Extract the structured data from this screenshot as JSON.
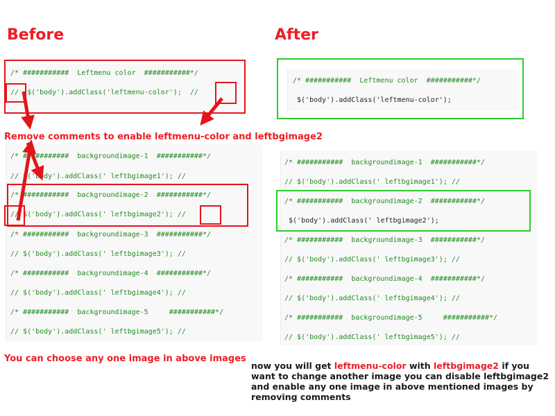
{
  "headings": {
    "before": "Before",
    "after": "After"
  },
  "before": {
    "top_code": [
      "/* ###########  Leftmenu color  ###########*/",
      "//  $('body').addClass('leftmenu-color');  //"
    ],
    "instruction": "Remove comments to enable leftmenu-color and leftbgimage2",
    "bg_code": [
      "/* ###########  backgroundimage-1  ###########*/",
      "// $('body').addClass(' leftbgimage1'); //",
      "/* ###########  backgroundimage-2  ###########*/",
      "// $('body').addClass(' leftbgimage2'); //",
      "/* ###########  backgroundimage-3  ###########*/",
      "// $('body').addClass(' leftbgimage3'); //",
      "/* ###########  backgroundimage-4  ###########*/",
      "// $('body').addClass(' leftbgimage4'); //",
      "/* ###########  backgroundimage-5     ###########*/",
      "// $('body').addClass(' leftbgimage5'); //"
    ],
    "footer": "You can choose any one image in above images"
  },
  "after": {
    "top_code": [
      "/* ###########  Leftmenu color  ###########*/",
      " $('body').addClass('leftmenu-color');"
    ],
    "bg_code": [
      "/* ###########  backgroundimage-1  ###########*/",
      "// $('body').addClass(' leftbgimage1'); //",
      "/* ###########  backgroundimage-2  ###########*/",
      " $('body').addClass(' leftbgimage2');",
      "/* ###########  backgroundimage-3  ###########*/",
      "// $('body').addClass(' leftbgimage3'); //",
      "/* ###########  backgroundimage-4  ###########*/",
      "// $('body').addClass(' leftbgimage4'); //",
      "/* ###########  backgroundimage-5     ###########*/",
      "// $('body').addClass(' leftbgimage5'); //"
    ]
  },
  "note": {
    "p1": "now you will get ",
    "hl1": "leftmenu-color",
    "p2": " with ",
    "hl2": "leftbgimage2",
    "p3": " if you want to change another image you can disable leftbgimage2 and enable any one image in above mentioned images by removing comments"
  },
  "colors": {
    "accent_red": "#ee1c25",
    "highlight_green": "#2bcc2b",
    "code_comment": "#1f8a1f"
  }
}
